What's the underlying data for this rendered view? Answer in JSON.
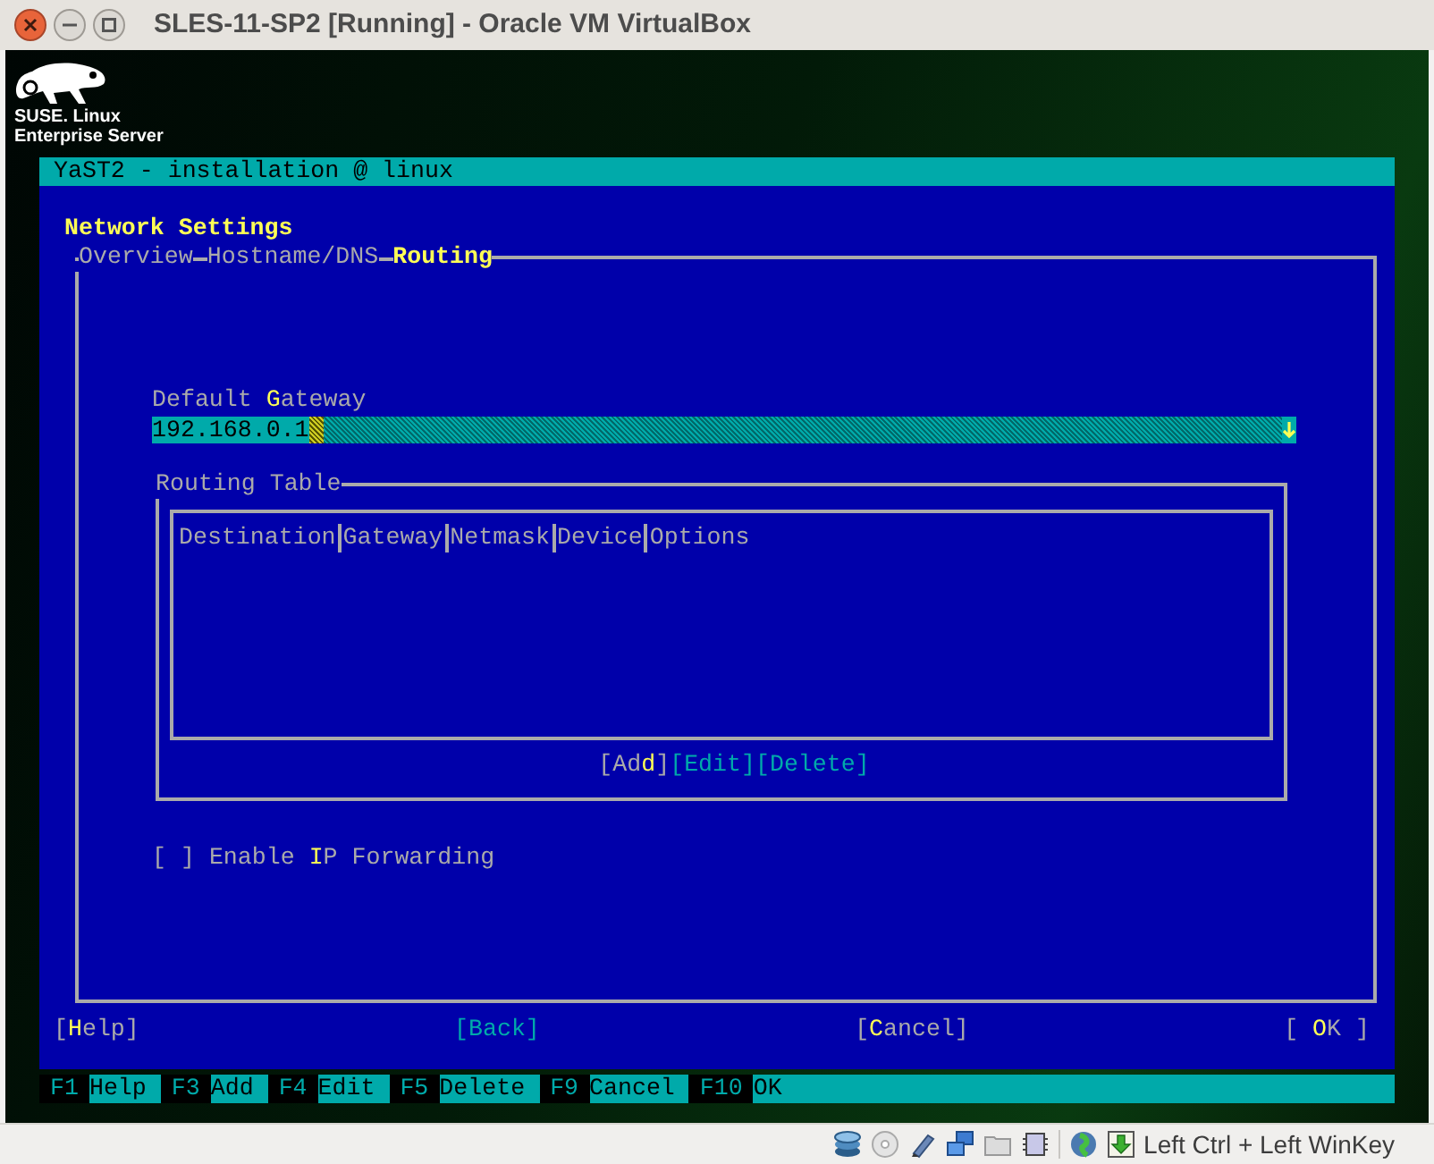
{
  "window": {
    "title": "SLES-11-SP2 [Running] - Oracle VM VirtualBox"
  },
  "logo": {
    "line_1": "SUSE. Linux",
    "line_2": "Enterprise Server"
  },
  "app_title": "YaST2 - installation @ linux",
  "dialog_title": "Network Settings",
  "tabs": [
    {
      "label": "Overview",
      "selected": false
    },
    {
      "label": "Hostname/DNS",
      "selected": false
    },
    {
      "label": "Routing",
      "selected": true
    }
  ],
  "gateway": {
    "label": {
      "pre": "Default ",
      "key": "G",
      "post": "ateway"
    },
    "value": "192.168.0.1"
  },
  "routing_table": {
    "title": "Routing Table",
    "columns": [
      "Destination",
      "Gateway",
      "Netmask",
      "Device",
      "Options"
    ],
    "buttons": [
      {
        "label": {
          "pre": "[Ad",
          "key": "d",
          "post": "]"
        },
        "disabled": false
      },
      {
        "label": {
          "pre": "[Edit]"
        },
        "disabled": true
      },
      {
        "label": {
          "pre": "[Delete]"
        },
        "disabled": true
      }
    ]
  },
  "ip_forwarding": {
    "box": "[ ]",
    "label": {
      "pre": "Enable ",
      "key": "I",
      "post": "P Forwarding"
    },
    "checked": false
  },
  "buttons": [
    {
      "label": {
        "pre": "[",
        "key": "H",
        "post": "elp]"
      },
      "disabled": false
    },
    {
      "label": {
        "pre": "[Back]"
      },
      "disabled": true
    },
    {
      "label": {
        "pre": "[",
        "key": "C",
        "post": "ancel]"
      },
      "disabled": false
    },
    {
      "label": {
        "pre": "[ ",
        "key": "O",
        "post": "K ]"
      },
      "disabled": false
    }
  ],
  "function_keys": [
    {
      "key": "F1",
      "label": "Help"
    },
    {
      "key": "F3",
      "label": "Add"
    },
    {
      "key": "F4",
      "label": "Edit"
    },
    {
      "key": "F5",
      "label": "Delete"
    },
    {
      "key": "F9",
      "label": "Cancel"
    },
    {
      "key": "F10",
      "label": "OK"
    }
  ],
  "status_bar": {
    "host_key": "Left Ctrl + Left WinKey"
  }
}
